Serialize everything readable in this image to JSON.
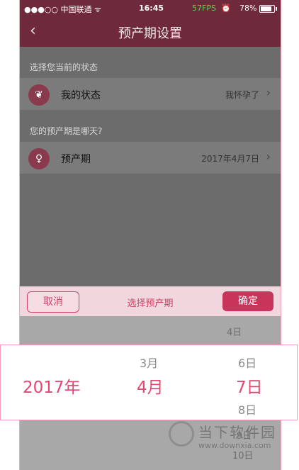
{
  "status_bar": {
    "carrier": "●●●○○ 中国联通 ᯤ",
    "time": "16:45",
    "fps": "57FPS",
    "clock_symbol": "⏰",
    "battery": "78%"
  },
  "nav": {
    "back_symbol": "‹",
    "title": "预产期设置"
  },
  "status_section": {
    "label": "选择您当前的状态",
    "row": {
      "icon": "sprout-icon",
      "title": "我的状态",
      "value": "我怀孕了",
      "chevron": "›"
    }
  },
  "due_section": {
    "label": "您的预产期是哪天?",
    "row": {
      "icon": "pregnant-icon",
      "title": "预产期",
      "value": "2017年4月7日",
      "chevron": "›"
    }
  },
  "picker": {
    "cancel_label": "取消",
    "title": "选择预产期",
    "confirm_label": "确定",
    "faint_above_day": "4日",
    "faint_below_day": "9日",
    "faint_bottom_day": "10日"
  },
  "zoom_picker": {
    "year": "2017年",
    "month_prev": "3月",
    "month_selected": "4月",
    "day_prev": "6日",
    "day_selected": "7日",
    "day_next": "8日"
  },
  "watermark": {
    "name": "当下软件园",
    "url": "www.downxia.com"
  },
  "colors": {
    "brand": "#c9345a",
    "accent_text": "#e54670",
    "nav_bg": "#6e2a3a"
  }
}
